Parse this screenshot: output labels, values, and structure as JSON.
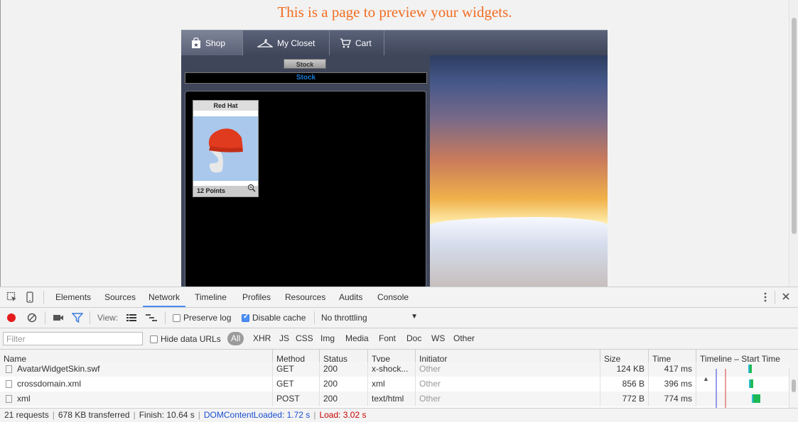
{
  "page": {
    "title": "This is a page to preview your widgets."
  },
  "widget": {
    "tabs": [
      {
        "label": "Shop",
        "icon": "shopping-bag-icon"
      },
      {
        "label": "My Closet",
        "icon": "hanger-icon"
      },
      {
        "label": "Cart",
        "icon": "cart-icon"
      }
    ],
    "stock_button": "Stock",
    "stock_bar": "Stock",
    "item": {
      "name": "Red Hat",
      "points": "12  Points"
    }
  },
  "devtools": {
    "tabs": [
      "Elements",
      "Sources",
      "Network",
      "Timeline",
      "Profiles",
      "Resources",
      "Audits",
      "Console"
    ],
    "active_tab": "Network",
    "toolbar": {
      "view_label": "View:",
      "preserve_log": "Preserve log",
      "disable_cache": "Disable cache",
      "throttling": "No throttling"
    },
    "filter": {
      "placeholder": "Filter",
      "hide_data_urls": "Hide data URLs",
      "types": [
        "All",
        "XHR",
        "JS",
        "CSS",
        "Img",
        "Media",
        "Font",
        "Doc",
        "WS",
        "Other"
      ]
    },
    "columns": [
      "Name",
      "Method",
      "Status",
      "Type",
      "Initiator",
      "Size",
      "Time",
      "Timeline – Start Time"
    ],
    "rows": [
      {
        "name": "AvatarWidgetSkin.swf",
        "method": "GET",
        "status": "200",
        "type": "x-shock...",
        "initiator": "Other",
        "size": "124 KB",
        "time": "417 ms"
      },
      {
        "name": "crossdomain.xml",
        "method": "GET",
        "status": "200",
        "type": "xml",
        "initiator": "Other",
        "size": "856 B",
        "time": "396 ms"
      },
      {
        "name": "xml",
        "method": "POST",
        "status": "200",
        "type": "text/html",
        "initiator": "Other",
        "size": "772 B",
        "time": "774 ms"
      }
    ],
    "status": {
      "requests": "21 requests",
      "transferred": "678 KB transferred",
      "finish": "Finish: 10.64 s",
      "dom_loaded": "DOMContentLoaded: 1.72 s",
      "load": "Load: 3.02 s"
    }
  }
}
